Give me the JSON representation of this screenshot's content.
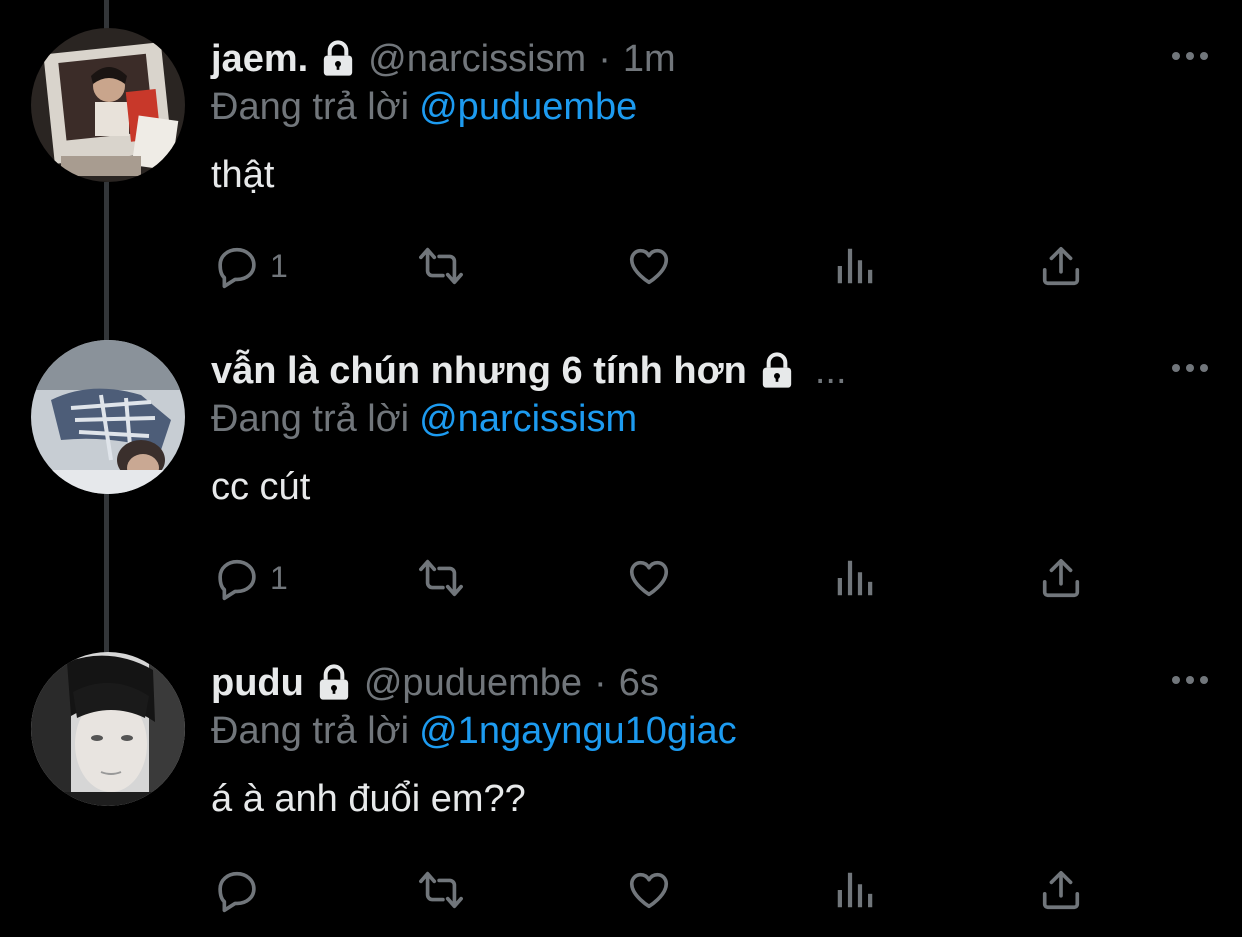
{
  "colors": {
    "background": "#000000",
    "text": "#e7e9ea",
    "muted": "#71767b",
    "accent": "#1d9bf0",
    "thread_line": "#333639"
  },
  "tweets": [
    {
      "name": "jaem.",
      "handle": "@narcissism",
      "separator": "·",
      "time": "1m",
      "name_truncation": "",
      "reply_label": "Đang trả lời",
      "reply_to": "@puduembe",
      "text": "thật",
      "reply_count": "1",
      "icons": [
        "lock-icon",
        "more-icon",
        "reply-icon",
        "retweet-icon",
        "like-icon",
        "analytics-icon",
        "share-icon"
      ]
    },
    {
      "name": "vẫn là chún nhưng 6 tính hơn",
      "handle": "",
      "separator": "",
      "time": "",
      "name_truncation": "...",
      "reply_label": "Đang trả lời",
      "reply_to": "@narcissism",
      "text": "cc cút",
      "reply_count": "1",
      "icons": [
        "lock-icon",
        "more-icon",
        "reply-icon",
        "retweet-icon",
        "like-icon",
        "analytics-icon",
        "share-icon"
      ]
    },
    {
      "name": "pudu",
      "handle": "@puduembe",
      "separator": "·",
      "time": "6s",
      "name_truncation": "",
      "reply_label": "Đang trả lời",
      "reply_to": "@1ngayngu10giac",
      "text": "á à anh đuổi em??",
      "reply_count": "",
      "icons": [
        "lock-icon",
        "more-icon",
        "reply-icon",
        "retweet-icon",
        "like-icon",
        "analytics-icon",
        "share-icon"
      ]
    }
  ]
}
